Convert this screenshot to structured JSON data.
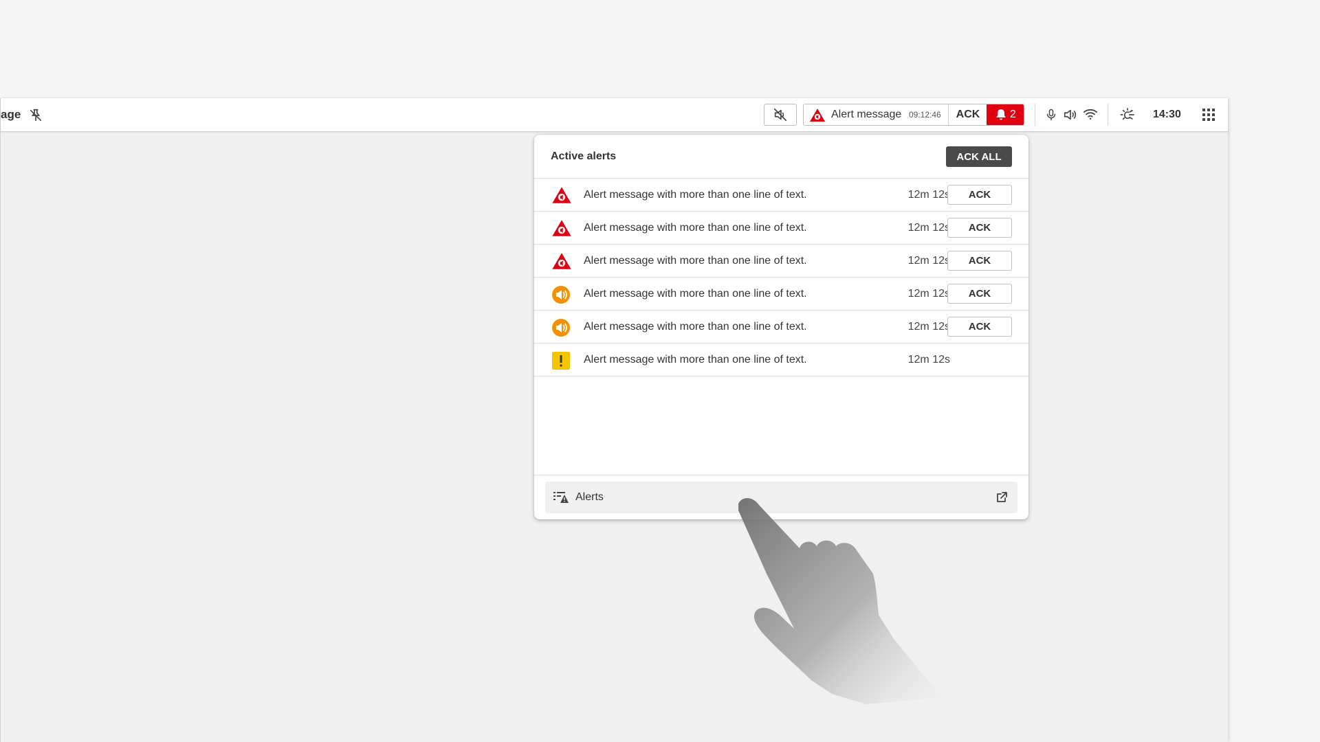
{
  "topbar": {
    "page_name_fragment": "age",
    "alarm_chip": {
      "message": "Alert message",
      "time": "09:12:46",
      "ack_label": "ACK",
      "count": "2"
    },
    "clock": "14:30",
    "icons": {
      "crossed_pin": "crossed-pin-icon",
      "mute": "speaker-muted-icon",
      "bell": "bell-icon",
      "microphone": "microphone-icon",
      "speaker": "speaker-icon",
      "wifi": "wifi-icon",
      "brightness": "brightness-icon",
      "apps": "apps-grid-icon"
    }
  },
  "panel": {
    "title": "Active alerts",
    "ack_all_label": "ACK ALL",
    "rows": [
      {
        "severity": "high",
        "message": "Alert message with more than one line of text.",
        "age": "12m 12s",
        "ack_label": "ACK"
      },
      {
        "severity": "high",
        "message": "Alert message with more than one line of text.",
        "age": "12m 12s",
        "ack_label": "ACK"
      },
      {
        "severity": "high",
        "message": "Alert message with more than one line of text.",
        "age": "12m 12s",
        "ack_label": "ACK"
      },
      {
        "severity": "medium",
        "message": "Alert message with more than one line of text.",
        "age": "12m 12s",
        "ack_label": "ACK"
      },
      {
        "severity": "medium",
        "message": "Alert message with more than one line of text.",
        "age": "12m 12s",
        "ack_label": "ACK"
      },
      {
        "severity": "low",
        "message": "Alert message with more than one line of text.",
        "age": "12m 12s",
        "ack_label": ""
      }
    ],
    "footer_link_label": "Alerts"
  },
  "colors": {
    "high": "#e1000f",
    "medium": "#f29200",
    "low": "#f2c500",
    "dark_button": "#4a4a4a"
  }
}
